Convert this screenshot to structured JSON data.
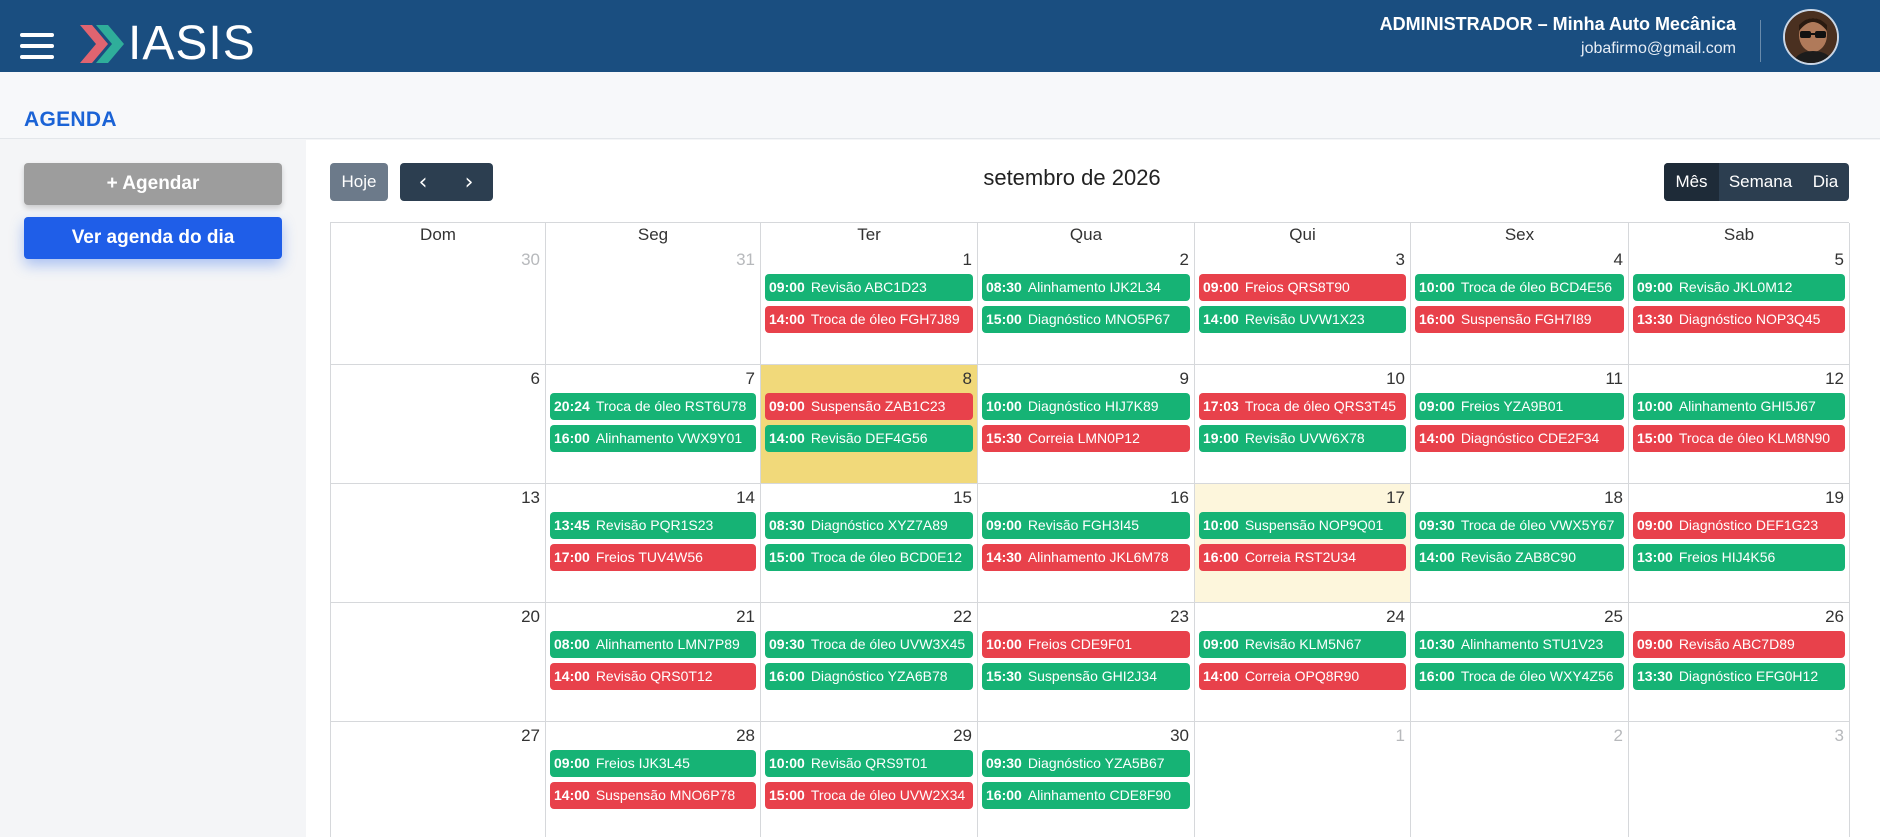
{
  "header": {
    "logo_text": "IASIS",
    "user_role": "ADMINISTRADOR – Minha Auto Mecânica",
    "user_email": "jobafirmo@gmail.com",
    "bg_color": "#1a4e80"
  },
  "page": {
    "title": "AGENDA"
  },
  "sidebar": {
    "agendar_label": "+ Agendar",
    "ver_agenda_label": "Ver agenda do dia"
  },
  "toolbar": {
    "today_label": "Hoje",
    "prev_icon": "chevron-left-icon",
    "next_icon": "chevron-right-icon",
    "title": "setembro de 2026",
    "views": [
      "Mês",
      "Semana",
      "Dia"
    ],
    "active_view": "Mês"
  },
  "colors": {
    "green": "#16b375",
    "red": "#e8414b",
    "today": "#f1d97a",
    "accent": "#1f5ee8"
  },
  "calendar": {
    "weekdays": [
      "Dom",
      "Seg",
      "Ter",
      "Qua",
      "Qui",
      "Sex",
      "Sab"
    ],
    "weeks": [
      [
        {
          "num": "30",
          "other": true,
          "events": []
        },
        {
          "num": "31",
          "other": true,
          "events": []
        },
        {
          "num": "1",
          "events": [
            {
              "time": "09:00",
              "title": "Revisão ABC1D23",
              "color": "green"
            },
            {
              "time": "14:00",
              "title": "Troca de óleo FGH7J89",
              "color": "red"
            }
          ]
        },
        {
          "num": "2",
          "events": [
            {
              "time": "08:30",
              "title": "Alinhamento IJK2L34",
              "color": "green"
            },
            {
              "time": "15:00",
              "title": "Diagnóstico MNO5P67",
              "color": "green"
            }
          ]
        },
        {
          "num": "3",
          "events": [
            {
              "time": "09:00",
              "title": "Freios QRS8T90",
              "color": "red"
            },
            {
              "time": "14:00",
              "title": "Revisão UVW1X23",
              "color": "green"
            }
          ]
        },
        {
          "num": "4",
          "events": [
            {
              "time": "10:00",
              "title": "Troca de óleo BCD4E56",
              "color": "green"
            },
            {
              "time": "16:00",
              "title": "Suspensão FGH7I89",
              "color": "red"
            }
          ]
        },
        {
          "num": "5",
          "events": [
            {
              "time": "09:00",
              "title": "Revisão JKL0M12",
              "color": "green"
            },
            {
              "time": "13:30",
              "title": "Diagnóstico NOP3Q45",
              "color": "red"
            }
          ]
        }
      ],
      [
        {
          "num": "6",
          "events": []
        },
        {
          "num": "7",
          "events": [
            {
              "time": "20:24",
              "title": "Troca de óleo RST6U78",
              "color": "green"
            },
            {
              "time": "16:00",
              "title": "Alinhamento VWX9Y01",
              "color": "green"
            }
          ]
        },
        {
          "num": "8",
          "today": true,
          "events": [
            {
              "time": "09:00",
              "title": "Suspensão ZAB1C23",
              "color": "red"
            },
            {
              "time": "14:00",
              "title": "Revisão DEF4G56",
              "color": "green"
            }
          ]
        },
        {
          "num": "9",
          "events": [
            {
              "time": "10:00",
              "title": "Diagnóstico HIJ7K89",
              "color": "green"
            },
            {
              "time": "15:30",
              "title": "Correia LMN0P12",
              "color": "red"
            }
          ]
        },
        {
          "num": "10",
          "events": [
            {
              "time": "17:03",
              "title": "Troca de óleo QRS3T45",
              "color": "red"
            },
            {
              "time": "19:00",
              "title": "Revisão UVW6X78",
              "color": "green"
            }
          ]
        },
        {
          "num": "11",
          "events": [
            {
              "time": "09:00",
              "title": "Freios YZA9B01",
              "color": "green"
            },
            {
              "time": "14:00",
              "title": "Diagnóstico CDE2F34",
              "color": "red"
            }
          ]
        },
        {
          "num": "12",
          "events": [
            {
              "time": "10:00",
              "title": "Alinhamento GHI5J67",
              "color": "green"
            },
            {
              "time": "15:00",
              "title": "Troca de óleo KLM8N90",
              "color": "red"
            }
          ]
        }
      ],
      [
        {
          "num": "13",
          "events": []
        },
        {
          "num": "14",
          "events": [
            {
              "time": "13:45",
              "title": "Revisão PQR1S23",
              "color": "green"
            },
            {
              "time": "17:00",
              "title": "Freios TUV4W56",
              "color": "red"
            }
          ]
        },
        {
          "num": "15",
          "events": [
            {
              "time": "08:30",
              "title": "Diagnóstico XYZ7A89",
              "color": "green"
            },
            {
              "time": "15:00",
              "title": "Troca de óleo BCD0E12",
              "color": "green"
            }
          ]
        },
        {
          "num": "16",
          "events": [
            {
              "time": "09:00",
              "title": "Revisão FGH3I45",
              "color": "green"
            },
            {
              "time": "14:30",
              "title": "Alinhamento JKL6M78",
              "color": "red"
            }
          ]
        },
        {
          "num": "17",
          "highlight": true,
          "events": [
            {
              "time": "10:00",
              "title": "Suspensão NOP9Q01",
              "color": "green"
            },
            {
              "time": "16:00",
              "title": "Correia RST2U34",
              "color": "red"
            }
          ]
        },
        {
          "num": "18",
          "events": [
            {
              "time": "09:30",
              "title": "Troca de óleo VWX5Y67",
              "color": "green"
            },
            {
              "time": "14:00",
              "title": "Revisão ZAB8C90",
              "color": "green"
            }
          ]
        },
        {
          "num": "19",
          "events": [
            {
              "time": "09:00",
              "title": "Diagnóstico DEF1G23",
              "color": "red"
            },
            {
              "time": "13:00",
              "title": "Freios HIJ4K56",
              "color": "green"
            }
          ]
        }
      ],
      [
        {
          "num": "20",
          "events": []
        },
        {
          "num": "21",
          "events": [
            {
              "time": "08:00",
              "title": "Alinhamento LMN7P89",
              "color": "green"
            },
            {
              "time": "14:00",
              "title": "Revisão QRS0T12",
              "color": "red"
            }
          ]
        },
        {
          "num": "22",
          "events": [
            {
              "time": "09:30",
              "title": "Troca de óleo UVW3X45",
              "color": "green"
            },
            {
              "time": "16:00",
              "title": "Diagnóstico YZA6B78",
              "color": "green"
            }
          ]
        },
        {
          "num": "23",
          "events": [
            {
              "time": "10:00",
              "title": "Freios CDE9F01",
              "color": "red"
            },
            {
              "time": "15:30",
              "title": "Suspensão GHI2J34",
              "color": "green"
            }
          ]
        },
        {
          "num": "24",
          "events": [
            {
              "time": "09:00",
              "title": "Revisão KLM5N67",
              "color": "green"
            },
            {
              "time": "14:00",
              "title": "Correia OPQ8R90",
              "color": "red"
            }
          ]
        },
        {
          "num": "25",
          "events": [
            {
              "time": "10:30",
              "title": "Alinhamento STU1V23",
              "color": "green"
            },
            {
              "time": "16:00",
              "title": "Troca de óleo WXY4Z56",
              "color": "green"
            }
          ]
        },
        {
          "num": "26",
          "events": [
            {
              "time": "09:00",
              "title": "Revisão ABC7D89",
              "color": "red"
            },
            {
              "time": "13:30",
              "title": "Diagnóstico EFG0H12",
              "color": "green"
            }
          ]
        }
      ],
      [
        {
          "num": "27",
          "events": []
        },
        {
          "num": "28",
          "events": [
            {
              "time": "09:00",
              "title": "Freios IJK3L45",
              "color": "green"
            },
            {
              "time": "14:00",
              "title": "Suspensão MNO6P78",
              "color": "red"
            }
          ]
        },
        {
          "num": "29",
          "events": [
            {
              "time": "10:00",
              "title": "Revisão QRS9T01",
              "color": "green"
            },
            {
              "time": "15:00",
              "title": "Troca de óleo UVW2X34",
              "color": "red"
            }
          ]
        },
        {
          "num": "30",
          "events": [
            {
              "time": "09:30",
              "title": "Diagnóstico YZA5B67",
              "color": "green"
            },
            {
              "time": "16:00",
              "title": "Alinhamento CDE8F90",
              "color": "green"
            }
          ]
        },
        {
          "num": "1",
          "other": true,
          "events": []
        },
        {
          "num": "2",
          "other": true,
          "events": []
        },
        {
          "num": "3",
          "other": true,
          "events": []
        }
      ]
    ]
  }
}
